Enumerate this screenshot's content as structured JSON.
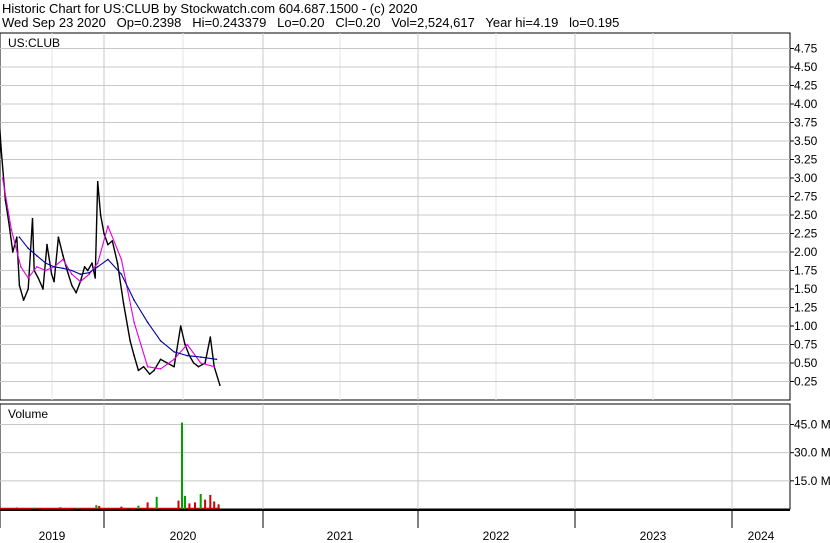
{
  "header": {
    "line1": "Historic Chart for US:CLUB by Stockwatch.com 604.687.1500 - (c) 2020",
    "line2": "Wed Sep 23 2020   Op=0.2398   Hi=0.243379   Lo=0.20   Cl=0.20   Vol=2,524,617   Year hi=4.19   lo=0.195"
  },
  "colors": {
    "grid": "#c8c8c8",
    "price": "#000000",
    "ma_short": "#e000e0",
    "ma_long": "#0000a0",
    "volume_up": "#00a000",
    "volume_down": "#d00000"
  },
  "chart_data": [
    {
      "type": "line",
      "title": "US:CLUB",
      "ylim": [
        0,
        5
      ],
      "y_ticks": [
        "4.75",
        "4.50",
        "4.25",
        "4.00",
        "3.75",
        "3.50",
        "3.25",
        "3.00",
        "2.75",
        "2.50",
        "2.25",
        "2.00",
        "1.75",
        "1.50",
        "1.25",
        "1.00",
        "0.75",
        "0.50",
        "0.25"
      ],
      "y_tick_values": [
        4.75,
        4.5,
        4.25,
        4.0,
        3.75,
        3.5,
        3.25,
        3.0,
        2.75,
        2.5,
        2.25,
        2.0,
        1.75,
        1.5,
        1.25,
        1.0,
        0.75,
        0.5,
        0.25
      ],
      "x_ticks": [
        "2019",
        "2020",
        "2021",
        "2022",
        "2023",
        "2024"
      ],
      "series": [
        {
          "key": "price",
          "x": [
            "2018-12-25",
            "2019-01-05",
            "2019-01-20",
            "2019-02-01",
            "2019-02-15",
            "2019-03-01",
            "2019-03-10",
            "2019-03-25",
            "2019-04-10",
            "2019-04-25",
            "2019-05-01",
            "2019-05-15",
            "2019-06-01",
            "2019-06-15",
            "2019-07-01",
            "2019-07-10",
            "2019-07-25",
            "2019-08-10",
            "2019-08-25",
            "2019-09-10",
            "2019-09-25",
            "2019-10-10",
            "2019-10-25",
            "2019-11-05",
            "2019-11-20",
            "2019-12-01",
            "2019-12-10",
            "2019-12-20",
            "2020-01-01",
            "2020-01-10",
            "2020-01-20",
            "2020-02-01",
            "2020-02-15",
            "2020-03-01",
            "2020-03-10",
            "2020-03-20",
            "2020-04-01",
            "2020-04-15",
            "2020-04-25",
            "2020-05-10",
            "2020-05-25",
            "2020-06-10",
            "2020-06-25",
            "2020-07-05",
            "2020-07-15",
            "2020-07-25",
            "2020-08-05",
            "2020-08-20",
            "2020-09-01",
            "2020-09-10",
            "2020-09-23"
          ],
          "values": [
            4.05,
            3.4,
            2.7,
            2.4,
            2.0,
            2.2,
            1.55,
            1.35,
            1.5,
            2.45,
            1.75,
            1.65,
            1.5,
            2.1,
            1.7,
            1.6,
            2.2,
            1.95,
            1.75,
            1.55,
            1.45,
            1.6,
            1.8,
            1.75,
            1.85,
            1.65,
            2.95,
            2.5,
            2.25,
            2.1,
            2.15,
            1.85,
            1.3,
            0.8,
            0.6,
            0.4,
            0.45,
            0.35,
            0.4,
            0.55,
            0.5,
            0.45,
            1.0,
            0.75,
            0.6,
            0.5,
            0.45,
            0.5,
            0.85,
            0.45,
            0.2
          ]
        },
        {
          "key": "ma_short",
          "x": [
            "2019-01-10",
            "2019-02-10",
            "2019-03-15",
            "2019-04-10",
            "2019-05-10",
            "2019-06-10",
            "2019-07-10",
            "2019-08-10",
            "2019-09-10",
            "2019-10-10",
            "2019-11-10",
            "2019-12-10",
            "2020-01-10",
            "2020-02-10",
            "2020-03-10",
            "2020-04-10",
            "2020-05-10",
            "2020-06-10",
            "2020-07-10",
            "2020-08-10",
            "2020-09-10"
          ],
          "values": [
            3.0,
            2.3,
            1.8,
            1.65,
            1.8,
            1.75,
            1.8,
            1.9,
            1.7,
            1.6,
            1.7,
            1.85,
            2.35,
            1.9,
            1.05,
            0.45,
            0.42,
            0.55,
            0.75,
            0.5,
            0.45
          ]
        },
        {
          "key": "ma_long",
          "x": [
            "2019-03-10",
            "2019-04-10",
            "2019-05-10",
            "2019-06-10",
            "2019-07-10",
            "2019-08-10",
            "2019-09-10",
            "2019-10-10",
            "2019-11-10",
            "2019-12-10",
            "2020-01-10",
            "2020-02-10",
            "2020-03-10",
            "2020-04-10",
            "2020-05-10",
            "2020-06-10",
            "2020-07-10",
            "2020-08-10",
            "2020-09-15"
          ],
          "values": [
            2.2,
            2.05,
            1.95,
            1.85,
            1.8,
            1.78,
            1.75,
            1.7,
            1.72,
            1.8,
            1.9,
            1.7,
            1.35,
            1.05,
            0.8,
            0.65,
            0.6,
            0.58,
            0.55
          ]
        }
      ]
    },
    {
      "type": "bar",
      "title": "Volume",
      "ylim": [
        0,
        54
      ],
      "y_unit": "M",
      "y_ticks": [
        "45.0 M",
        "30.0 M",
        "15.0 M"
      ],
      "y_tick_values": [
        45,
        30,
        15
      ],
      "bars": [
        {
          "date": "2019-03-01",
          "value": 0.8,
          "dir": "down"
        },
        {
          "date": "2019-05-01",
          "value": 0.7,
          "dir": "up"
        },
        {
          "date": "2019-08-01",
          "value": 0.9,
          "dir": "down"
        },
        {
          "date": "2019-10-01",
          "value": 0.6,
          "dir": "up"
        },
        {
          "date": "2019-12-05",
          "value": 2.0,
          "dir": "up"
        },
        {
          "date": "2019-12-15",
          "value": 1.6,
          "dir": "down"
        },
        {
          "date": "2020-02-10",
          "value": 1.3,
          "dir": "down"
        },
        {
          "date": "2020-03-20",
          "value": 1.8,
          "dir": "up"
        },
        {
          "date": "2020-04-10",
          "value": 3.5,
          "dir": "down"
        },
        {
          "date": "2020-05-01",
          "value": 6.5,
          "dir": "up"
        },
        {
          "date": "2020-06-20",
          "value": 4.5,
          "dir": "down"
        },
        {
          "date": "2020-06-28",
          "value": 46.0,
          "dir": "up"
        },
        {
          "date": "2020-07-05",
          "value": 7.0,
          "dir": "up"
        },
        {
          "date": "2020-07-15",
          "value": 3.0,
          "dir": "down"
        },
        {
          "date": "2020-07-28",
          "value": 3.5,
          "dir": "down"
        },
        {
          "date": "2020-08-10",
          "value": 8.0,
          "dir": "up"
        },
        {
          "date": "2020-08-20",
          "value": 5.0,
          "dir": "down"
        },
        {
          "date": "2020-09-01",
          "value": 7.5,
          "dir": "down"
        },
        {
          "date": "2020-09-10",
          "value": 4.0,
          "dir": "down"
        },
        {
          "date": "2020-09-20",
          "value": 2.5,
          "dir": "down"
        }
      ]
    }
  ]
}
